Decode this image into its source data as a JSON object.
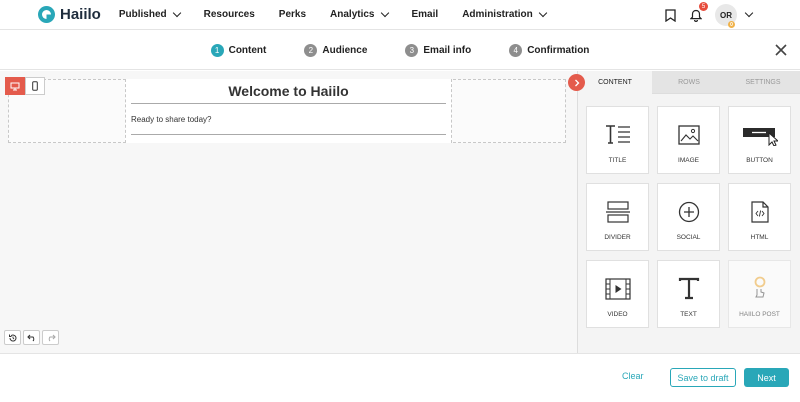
{
  "brand": {
    "name": "Haiilo",
    "accent": "#29a7b8",
    "danger": "#e45b4c"
  },
  "nav": {
    "items": [
      {
        "label": "Published",
        "dropdown": true
      },
      {
        "label": "Resources",
        "dropdown": false
      },
      {
        "label": "Perks",
        "dropdown": false
      },
      {
        "label": "Analytics",
        "dropdown": true
      },
      {
        "label": "Email",
        "dropdown": false
      },
      {
        "label": "Administration",
        "dropdown": true
      }
    ],
    "notification_count": "5",
    "avatar_initials": "OR",
    "avatar_badge": "0"
  },
  "stepper": {
    "steps": [
      {
        "num": "1",
        "label": "Content",
        "active": true
      },
      {
        "num": "2",
        "label": "Audience",
        "active": false
      },
      {
        "num": "3",
        "label": "Email info",
        "active": false
      },
      {
        "num": "4",
        "label": "Confirmation",
        "active": false
      }
    ]
  },
  "editor": {
    "email_title": "Welcome to Haiilo",
    "email_text": "Ready to share today?"
  },
  "panel": {
    "tabs": [
      "CONTENT",
      "ROWS",
      "SETTINGS"
    ],
    "blocks": [
      {
        "label": "TITLE",
        "icon": "title-icon"
      },
      {
        "label": "IMAGE",
        "icon": "image-icon"
      },
      {
        "label": "BUTTON",
        "icon": "button-icon"
      },
      {
        "label": "DIVIDER",
        "icon": "divider-icon"
      },
      {
        "label": "SOCIAL",
        "icon": "social-icon"
      },
      {
        "label": "HTML",
        "icon": "html-icon"
      },
      {
        "label": "VIDEO",
        "icon": "video-icon"
      },
      {
        "label": "TEXT",
        "icon": "text-icon"
      },
      {
        "label": "HAIILO POST",
        "icon": "haiilo-post-icon"
      }
    ]
  },
  "footer": {
    "clear": "Clear",
    "save_draft": "Save to draft",
    "next": "Next"
  }
}
